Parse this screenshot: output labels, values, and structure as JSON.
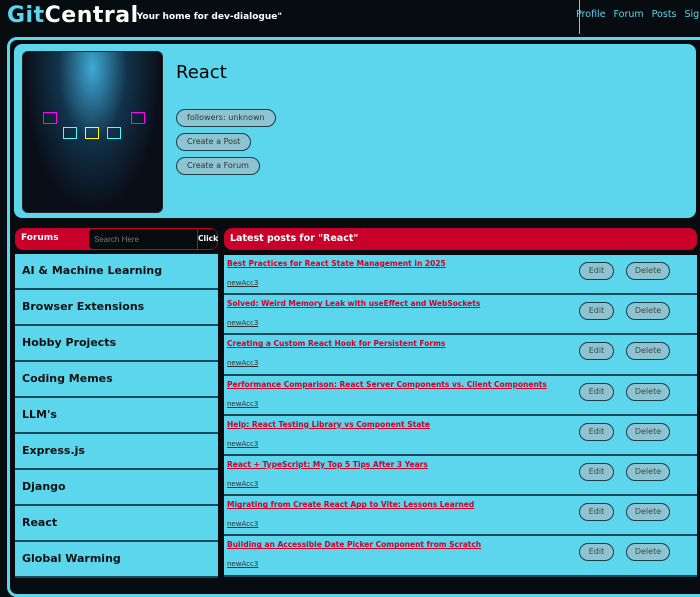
{
  "header": {
    "logo_git": "Git",
    "logo_central": "Central",
    "tagline": "\"Your home for dev-dialogue\"",
    "nav": [
      "Profile",
      "Forum",
      "Posts",
      "Sign Out"
    ]
  },
  "profile": {
    "name": "React",
    "followers": "followers: unknown",
    "create_post": "Create a Post",
    "create_forum": "Create a Forum"
  },
  "forums": {
    "title": "Forums",
    "search_placeholder": "Search Here",
    "search_button": "Click",
    "items": [
      "AI & Machine Learning",
      "Browser Extensions",
      "Hobby Projects",
      "Coding Memes",
      "LLM's",
      "Express.js",
      "Django",
      "React",
      "Global Warming"
    ]
  },
  "posts": {
    "title": "Latest posts for \"React\"",
    "edit_label": "Edit",
    "delete_label": "Delete",
    "items": [
      {
        "title": "Best Practices for React State Management in 2025",
        "author": "newAcc3"
      },
      {
        "title": "Solved: Weird Memory Leak with useEffect and WebSockets",
        "author": "newAcc3"
      },
      {
        "title": "Creating a Custom React Hook for Persistent Forms",
        "author": "newAcc3"
      },
      {
        "title": "Performance Comparison: React Server Components vs. Client Components",
        "author": "newAcc3"
      },
      {
        "title": "Help: React Testing Library vs Component State",
        "author": "newAcc3"
      },
      {
        "title": "React + TypeScript: My Top 5 Tips After 3 Years",
        "author": "newAcc3"
      },
      {
        "title": "Migrating from Create React App to Vite: Lessons Learned",
        "author": "newAcc3"
      },
      {
        "title": "Building an Accessible Date Picker Component from Scratch",
        "author": "newAcc3"
      }
    ]
  }
}
